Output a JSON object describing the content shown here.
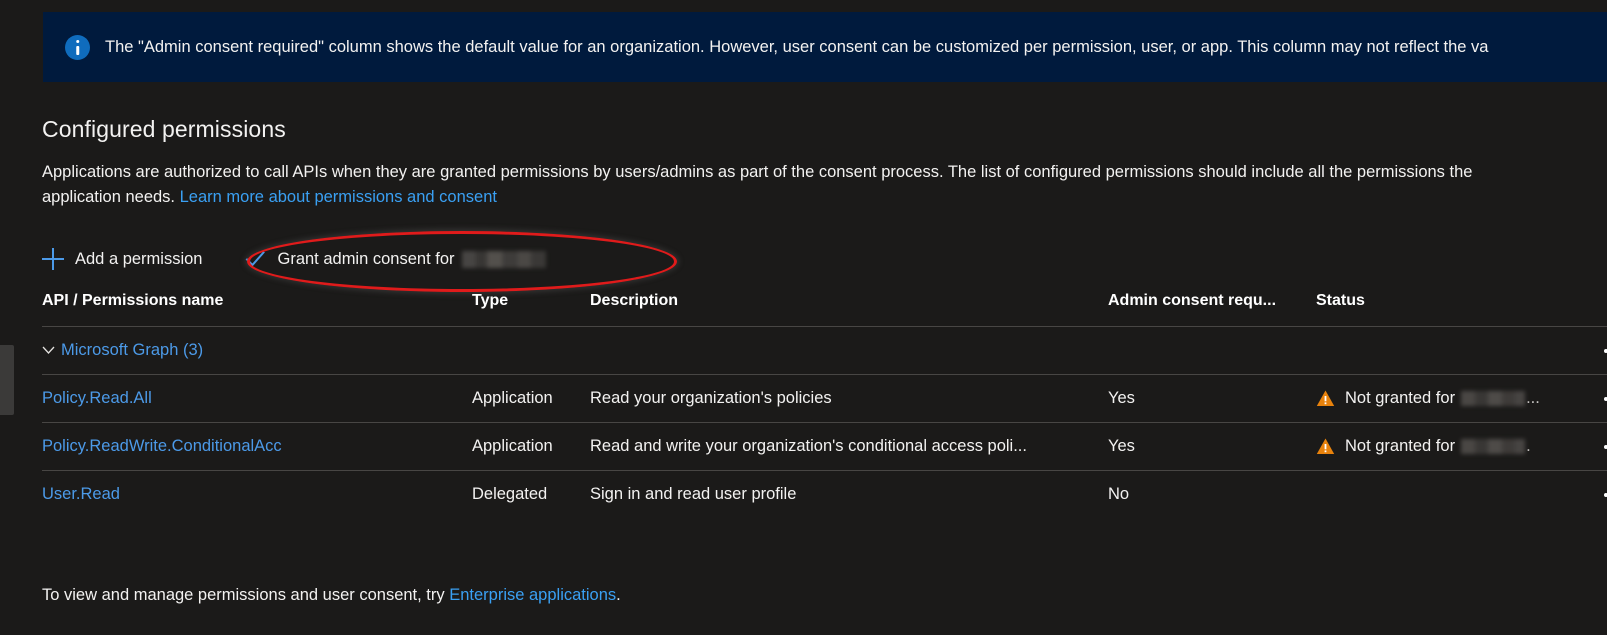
{
  "banner": {
    "icon": "info-icon",
    "text": "The \"Admin consent required\" column shows the default value for an organization. However, user consent can be customized per permission, user, or app. This column may not reflect the va",
    "background_color": "#001a3d",
    "icon_color": "#0f6cbd"
  },
  "section": {
    "title": "Configured permissions",
    "description_part1": "Applications are authorized to call APIs when they are granted permissions by users/admins as part of the consent process. The list of configured permissions should include all the permissions the application needs. ",
    "description_link": "Learn more about permissions and consent"
  },
  "command_bar": {
    "add_permission_label": "Add a permission",
    "grant_consent_label": "Grant admin consent for",
    "grant_consent_tenant_redacted": "",
    "accent_color": "#4c9ae8"
  },
  "annotation": {
    "shape": "ellipse",
    "color": "#e01b1b",
    "targets": "grant-admin-consent-button"
  },
  "table": {
    "columns": [
      "API / Permissions name",
      "Type",
      "Description",
      "Admin consent requ...",
      "Status",
      ""
    ],
    "rows": [
      {
        "kind": "group",
        "name": "Microsoft Graph (3)",
        "type": "",
        "description": "",
        "admin_consent_required": "",
        "status_icon": "",
        "status": "",
        "status_tenant_redacted": "",
        "status_truncation": ""
      },
      {
        "kind": "permission",
        "name": "Policy.Read.All",
        "type": "Application",
        "description": "Read your organization's policies",
        "admin_consent_required": "Yes",
        "status_icon": "warning-icon",
        "status": "Not granted for",
        "status_tenant_redacted": "",
        "status_truncation": "..."
      },
      {
        "kind": "permission",
        "name": "Policy.ReadWrite.ConditionalAcc",
        "type": "Application",
        "description": "Read and write your organization's conditional access poli...",
        "admin_consent_required": "Yes",
        "status_icon": "warning-icon",
        "status": "Not granted for",
        "status_tenant_redacted": "",
        "status_truncation": "."
      },
      {
        "kind": "permission",
        "name": "User.Read",
        "type": "Delegated",
        "description": "Sign in and read user profile",
        "admin_consent_required": "No",
        "status_icon": "",
        "status": "",
        "status_tenant_redacted": "",
        "status_truncation": ""
      }
    ],
    "row_action_label": "•••",
    "link_color": "#4c9ae8",
    "warning_color": "#e8820c"
  },
  "footer": {
    "text_part1": "To view and manage permissions and user consent, try ",
    "link": "Enterprise applications",
    "text_part2": "."
  }
}
